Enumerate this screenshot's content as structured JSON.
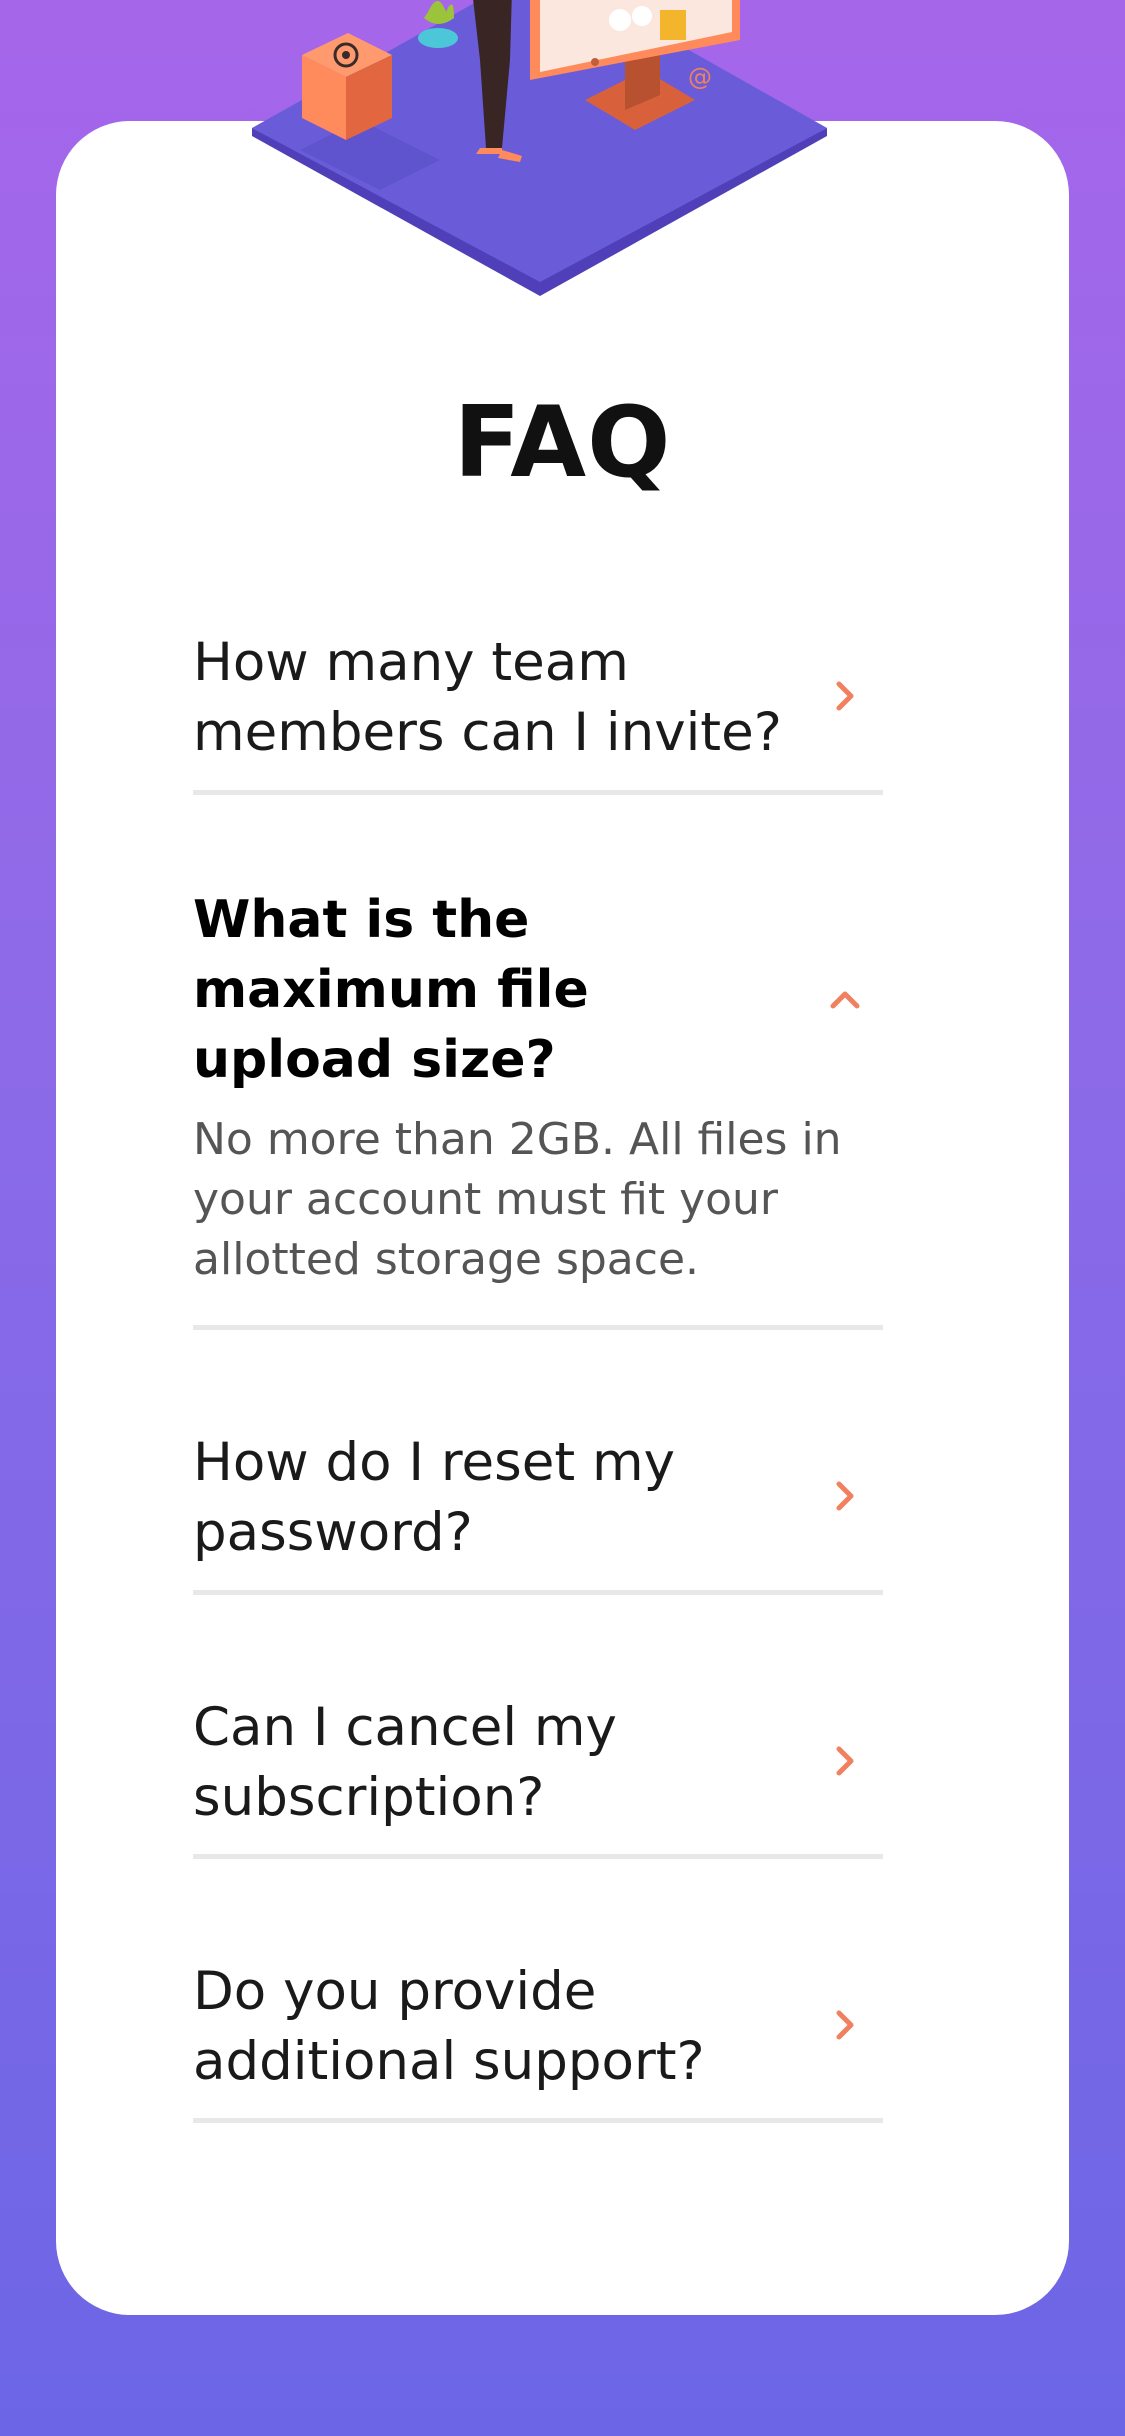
{
  "faq": {
    "title": "FAQ",
    "items": [
      {
        "question": "How many team members can I invite?",
        "expanded": false,
        "icon": "chevron-right-icon"
      },
      {
        "question": "What is the maximum file upload size?",
        "answer": "No more than 2GB. All files in your account must fit your allotted storage space.",
        "expanded": true,
        "icon": "chevron-up-icon"
      },
      {
        "question": "How do I reset my password?",
        "expanded": false,
        "icon": "chevron-right-icon"
      },
      {
        "question": "Can I cancel my subscription?",
        "expanded": false,
        "icon": "chevron-right-icon"
      },
      {
        "question": "Do you provide additional support?",
        "expanded": false,
        "icon": "chevron-right-icon"
      }
    ]
  },
  "colors": {
    "accent": "#f0805f",
    "background_top": "#a666ea",
    "background_bottom": "#6c66e6",
    "card": "#ffffff",
    "divider": "#e8e8e8"
  }
}
